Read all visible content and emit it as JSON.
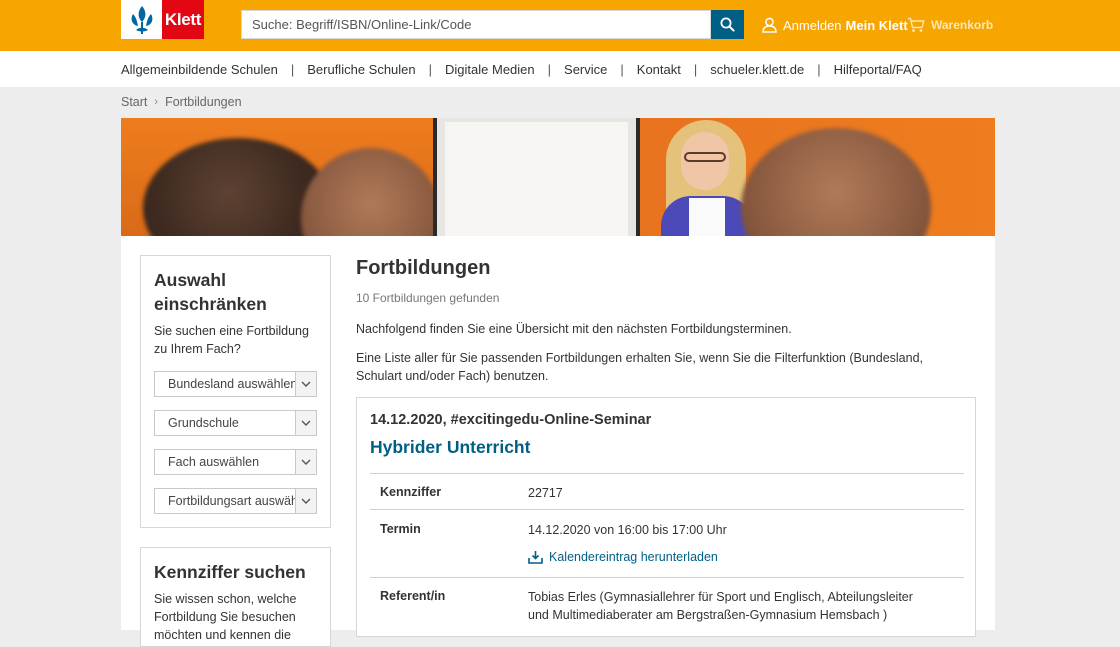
{
  "header": {
    "logo_text": "Klett",
    "search_placeholder": "Suche: Begriff/ISBN/Online-Link/Code",
    "login_label": "Anmelden",
    "login_bold": "Mein Klett",
    "cart_label": "Warenkorb"
  },
  "nav": {
    "items": [
      "Allgemeinbildende Schulen",
      "Berufliche Schulen",
      "Digitale Medien",
      "Service",
      "Kontakt",
      "schueler.klett.de",
      "Hilfeportal/FAQ"
    ],
    "separator": "|"
  },
  "breadcrumb": {
    "items": [
      "Start",
      "Fortbildungen"
    ],
    "chevron": "›"
  },
  "sidebar": {
    "filter": {
      "title": "Auswahl einschränken",
      "text": "Sie suchen eine Fortbildung zu Ihrem Fach?",
      "selects": [
        "Bundesland auswählen",
        "Grundschule",
        "Fach auswählen",
        "Fortbildungsart auswählen"
      ]
    },
    "code_search": {
      "title": "Kennziffer suchen",
      "text": "Sie wissen schon, welche Fortbildung Sie besuchen möchten und kennen die"
    }
  },
  "main": {
    "title": "Fortbildungen",
    "count": "10 Fortbildungen gefunden",
    "intro1": "Nachfolgend finden Sie eine Übersicht mit den nächsten Fortbildungsterminen.",
    "intro2": "Eine Liste aller für Sie passenden Fortbildungen erhalten Sie, wenn Sie die Filterfunktion (Bundesland, Schulart und/oder Fach) benutzen."
  },
  "event": {
    "date": "14.12.2020, #excitingedu-Online-Seminar",
    "title": "Hybrider Unterricht",
    "kennziffer_label": "Kennziffer",
    "kennziffer": "22717",
    "termin_label": "Termin",
    "termin": "14.12.2020 von 16:00 bis 17:00 Uhr",
    "calendar_link": "Kalendereintrag herunterladen",
    "referent_label": "Referent/in",
    "referent": "Tobias Erles (Gymnasiallehrer für Sport und Englisch, Abteilungsleiter und Multimediaberater am Bergstraßen-Gymnasium Hemsbach )"
  },
  "colors": {
    "brand_orange": "#f7a500",
    "brand_red": "#e30613",
    "link_blue": "#005f84"
  },
  "icons": [
    "klett-logo-icon",
    "search-icon",
    "user-icon",
    "cart-icon",
    "chevron-down-icon",
    "calendar-download-icon"
  ]
}
